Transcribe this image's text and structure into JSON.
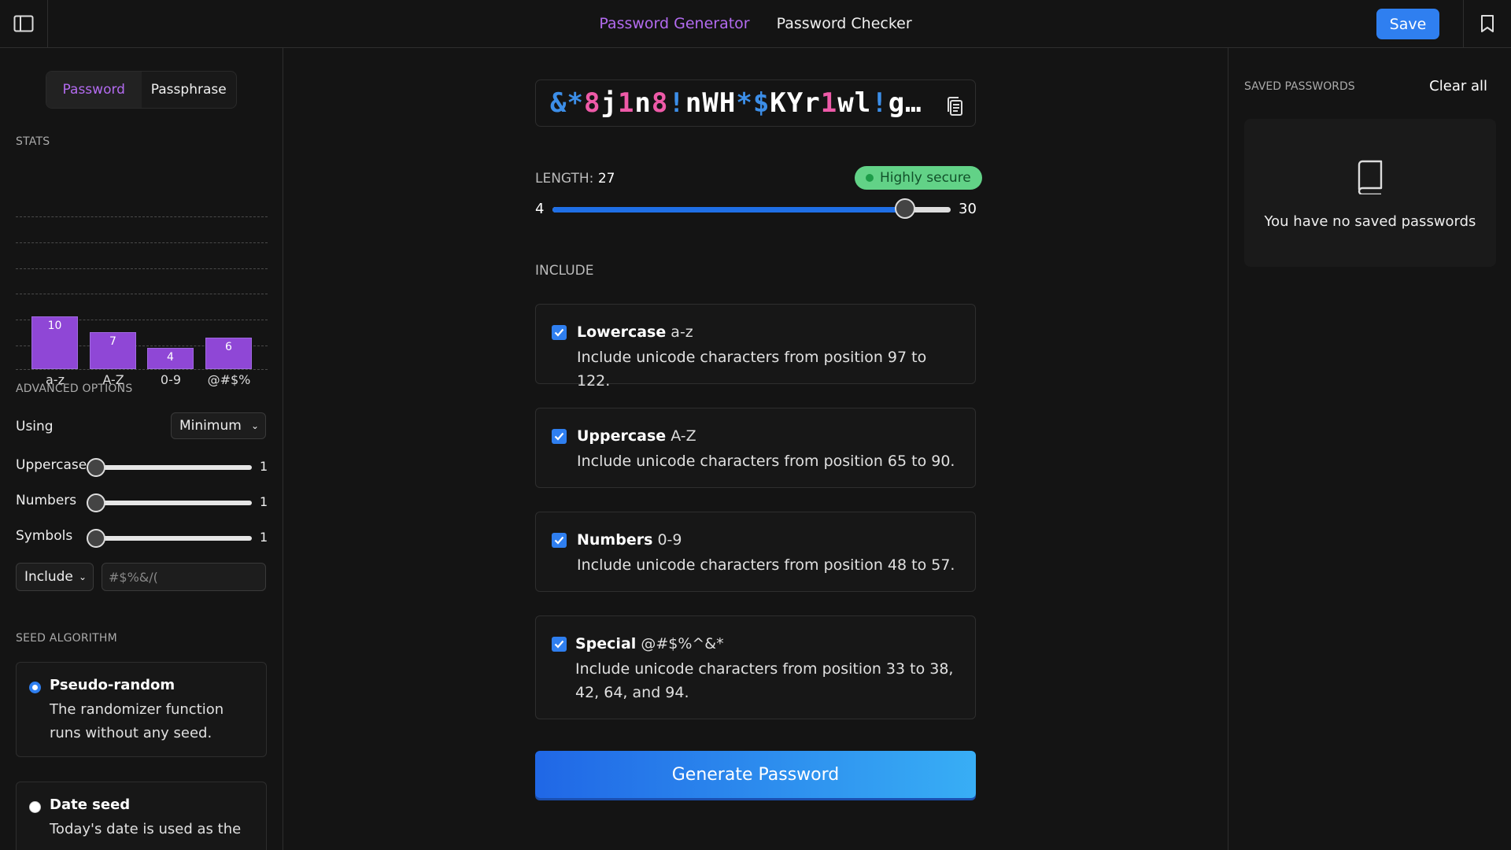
{
  "nav": {
    "tabs": [
      {
        "label": "Password Generator",
        "active": true
      },
      {
        "label": "Password Checker",
        "active": false
      }
    ],
    "save_label": "Save"
  },
  "sidebar": {
    "mode_tabs": [
      {
        "label": "Password",
        "active": true
      },
      {
        "label": "Passphrase",
        "active": false
      }
    ],
    "stats_title": "STATS",
    "advanced_title": "ADVANCED OPTIONS",
    "using_label": "Using",
    "using_value": "Minimum",
    "sliders": [
      {
        "label": "Uppercase",
        "value": "1"
      },
      {
        "label": "Numbers",
        "value": "1"
      },
      {
        "label": "Symbols",
        "value": "1"
      }
    ],
    "include_select": "Include",
    "chars_placeholder": "#$%&/(",
    "seed_title": "SEED ALGORITHM",
    "seeds": [
      {
        "title": "Pseudo-random",
        "desc": "The randomizer function runs without any seed.",
        "checked": true
      },
      {
        "title": "Date seed",
        "desc": "Today's date is used as the",
        "checked": false
      }
    ]
  },
  "chart_data": {
    "type": "bar",
    "categories": [
      "a-z",
      "A-Z",
      "0-9",
      "@#$%"
    ],
    "values": [
      10,
      7,
      4,
      6
    ],
    "ylim": [
      0,
      22
    ],
    "grid": true,
    "color": "#8f47d6"
  },
  "main": {
    "password": "&*8j1n8!nWH*$KYr1wl!gi…",
    "length_label": "LENGTH:",
    "length_value": "27",
    "strength": "Highly secure",
    "min": "4",
    "max": "30",
    "slider_value": 27,
    "include_title": "INCLUDE",
    "options": [
      {
        "name": "Lowercase",
        "range": "a-z",
        "desc": "Include unicode characters from position 97 to 122.",
        "checked": true
      },
      {
        "name": "Uppercase",
        "range": "A-Z",
        "desc": "Include unicode characters from position 65 to 90.",
        "checked": true
      },
      {
        "name": "Numbers",
        "range": "0-9",
        "desc": "Include unicode characters from position 48 to 57.",
        "checked": true
      },
      {
        "name": "Special",
        "range": "@#$%^&*",
        "desc": "Include unicode characters from position 33 to 38, 42, 64, and 94.",
        "checked": true
      }
    ],
    "generate_label": "Generate Password"
  },
  "saved": {
    "title": "SAVED PASSWORDS",
    "clear_label": "Clear all",
    "empty_text": "You have no saved passwords"
  },
  "colors": {
    "accent_purple": "#b36bf0",
    "primary_blue": "#2f7ff0",
    "pw_blue": "#3c8ee8",
    "pw_pink": "#ee5aa8",
    "secure_green": "#62d287"
  }
}
